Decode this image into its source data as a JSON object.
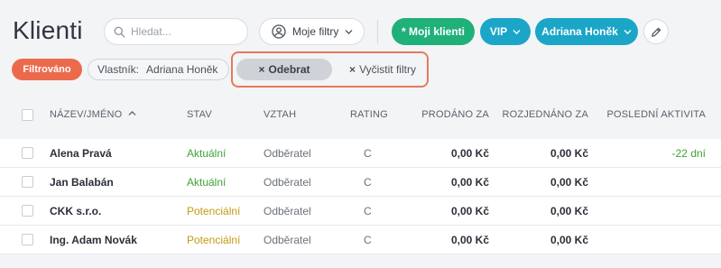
{
  "page": {
    "title": "Klienti"
  },
  "search": {
    "placeholder": "Hledat..."
  },
  "toolbar": {
    "my_filters_label": "Moje filtry",
    "chips": {
      "my_clients": "* Moji klienti",
      "vip": "VIP",
      "owner": "Adriana Honěk"
    }
  },
  "active_filters": {
    "filtered_badge": "Filtrováno",
    "owner_label": "Vlastník:",
    "owner_value": "Adriana Honěk",
    "remove_label": "Odebrat",
    "clear_label": "Vyčistit filtry"
  },
  "table": {
    "columns": {
      "name": "NÁZEV/JMÉNO",
      "status": "STAV",
      "relation": "VZTAH",
      "rating": "RATING",
      "sold": "PRODÁNO ZA",
      "negotiated": "ROZJEDNÁNO ZA",
      "last_activity": "POSLEDNÍ AKTIVITA"
    },
    "rows": [
      {
        "name": "Alena Pravá",
        "status": "Aktuální",
        "relation": "Odběratel",
        "rating": "C",
        "sold": "0,00 Kč",
        "negotiated": "0,00 Kč",
        "last_activity": "-22 dní"
      },
      {
        "name": "Jan Balabán",
        "status": "Aktuální",
        "relation": "Odběratel",
        "rating": "C",
        "sold": "0,00 Kč",
        "negotiated": "0,00 Kč",
        "last_activity": ""
      },
      {
        "name": "CKK s.r.o.",
        "status": "Potenciální",
        "relation": "Odběratel",
        "rating": "C",
        "sold": "0,00 Kč",
        "negotiated": "0,00 Kč",
        "last_activity": ""
      },
      {
        "name": "Ing. Adam Novák",
        "status": "Potenciální",
        "relation": "Odběratel",
        "rating": "C",
        "sold": "0,00 Kč",
        "negotiated": "0,00 Kč",
        "last_activity": ""
      }
    ]
  },
  "colors": {
    "status_current": "#3ea336",
    "status_potential": "#c49a12",
    "accent_green": "#20b07a",
    "accent_blue": "#1ba6c8",
    "filtered_badge": "#ec6a4c"
  },
  "icons": {
    "search": "search-icon",
    "filters": "user-circle-icon",
    "chevron": "chevron-down-icon",
    "edit": "pencil-icon",
    "sort": "sort-ascending-icon",
    "close": "close-icon"
  }
}
